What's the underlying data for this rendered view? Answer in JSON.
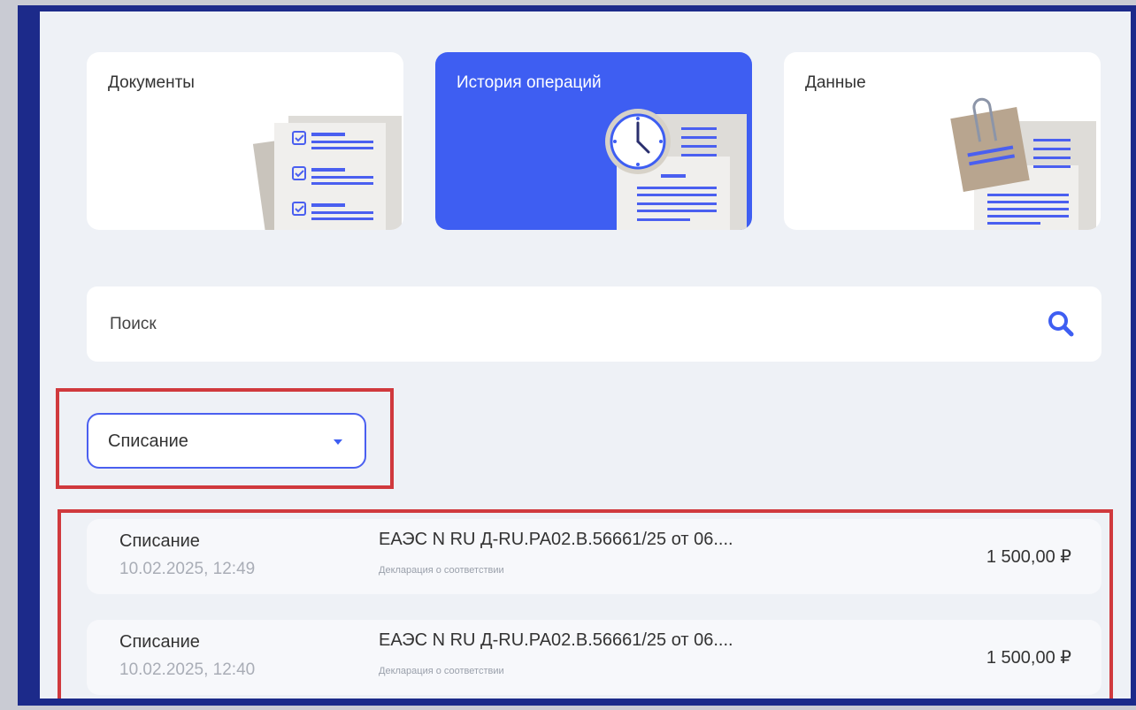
{
  "cards": [
    {
      "label": "Документы",
      "icon": "documents-checklist-icon"
    },
    {
      "label": "История операций",
      "icon": "clock-document-icon"
    },
    {
      "label": "Данные",
      "icon": "paperclip-note-icon"
    }
  ],
  "search": {
    "placeholder": "Поиск",
    "icon": "search-icon"
  },
  "filter": {
    "selected": "Списание",
    "icon": "caret-down-icon"
  },
  "operations": [
    {
      "type": "Списание",
      "date": "10.02.2025, 12:49",
      "title": "ЕАЭС N RU Д-RU.РА02.В.56661/25 от 06....",
      "subtitle": "Декларация о соответствии",
      "amount": "1 500,00 ₽"
    },
    {
      "type": "Списание",
      "date": "10.02.2025, 12:40",
      "title": "ЕАЭС N RU Д-RU.РА02.В.56661/25 от 06....",
      "subtitle": "Декларация о соответствии",
      "amount": "1 500,00 ₽"
    }
  ],
  "colors": {
    "accent": "#3e5ef2",
    "frame": "#1c2a8a",
    "highlight": "#d0393d"
  }
}
